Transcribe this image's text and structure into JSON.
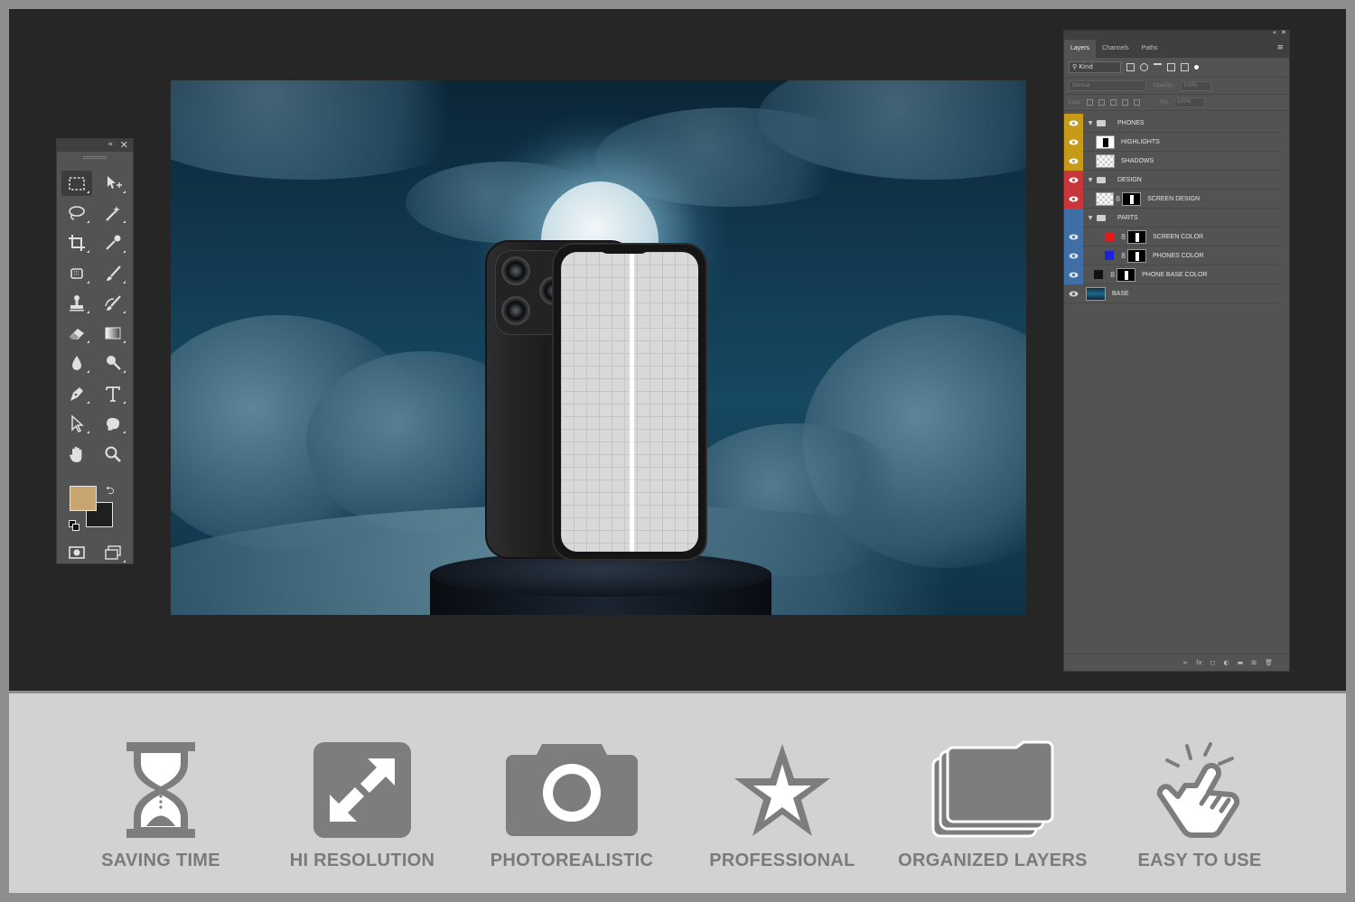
{
  "tools_panel": {
    "collapse_glyph": "«",
    "close_glyph": "✕",
    "tools": [
      {
        "name": "rectangular-marquee-tool",
        "icon": "marquee-icon",
        "selected": true
      },
      {
        "name": "move-tool",
        "icon": "move-icon"
      },
      {
        "name": "lasso-tool",
        "icon": "lasso-icon"
      },
      {
        "name": "magic-wand-tool",
        "icon": "magic-wand-icon"
      },
      {
        "name": "crop-tool",
        "icon": "crop-icon"
      },
      {
        "name": "eyedropper-tool",
        "icon": "eyedropper-icon"
      },
      {
        "name": "spot-healing-tool",
        "icon": "healing-icon"
      },
      {
        "name": "brush-tool",
        "icon": "brush-icon"
      },
      {
        "name": "clone-stamp-tool",
        "icon": "stamp-icon"
      },
      {
        "name": "history-brush-tool",
        "icon": "history-brush-icon"
      },
      {
        "name": "eraser-tool",
        "icon": "eraser-icon"
      },
      {
        "name": "gradient-tool",
        "icon": "gradient-icon"
      },
      {
        "name": "blur-tool",
        "icon": "blur-drop-icon"
      },
      {
        "name": "dodge-tool",
        "icon": "dodge-icon"
      },
      {
        "name": "pen-tool",
        "icon": "pen-icon"
      },
      {
        "name": "type-tool",
        "icon": "type-icon",
        "glyph": "T"
      },
      {
        "name": "path-selection-tool",
        "icon": "path-selection-icon"
      },
      {
        "name": "custom-shape-tool",
        "icon": "shape-icon"
      },
      {
        "name": "hand-tool",
        "icon": "hand-icon"
      },
      {
        "name": "zoom-tool",
        "icon": "zoom-icon"
      }
    ],
    "foreground_color": "#c8a46f",
    "background_color": "#1f1f1f",
    "swap_glyph": "⮌"
  },
  "layers_panel": {
    "collapse_glyph": "«",
    "close_glyph": "✕",
    "menu_glyph": "≡",
    "tabs": [
      {
        "label": "Layers",
        "active": true
      },
      {
        "label": "Channels",
        "active": false
      },
      {
        "label": "Paths",
        "active": false
      }
    ],
    "filter_label": "Kind",
    "blend_mode": "Normal",
    "opacity_label": "Opacity:",
    "opacity_value": "100%",
    "lock_label": "Lock:",
    "fill_label": "Fill:",
    "fill_value": "100%",
    "layers": [
      {
        "name": "PHONES",
        "type": "group",
        "color": "#c79b17",
        "indent": 0
      },
      {
        "name": "HIGHLIGHTS",
        "type": "layer",
        "color": "#c79b17",
        "indent": 1,
        "thumb": "checker-dark"
      },
      {
        "name": "SHADOWS",
        "type": "layer",
        "color": "#c79b17",
        "indent": 1,
        "thumb": "checker"
      },
      {
        "name": "DESIGN",
        "type": "group",
        "color": "#c8353a",
        "indent": 0
      },
      {
        "name": "SCREEN DESIGN",
        "type": "smart",
        "color": "#c8353a",
        "indent": 1
      },
      {
        "name": "PARTS",
        "type": "group",
        "color": "#3f6fa6",
        "indent": 0,
        "hidden": true
      },
      {
        "name": "SCREEN COLOR",
        "type": "fill",
        "color": "#3f6fa6",
        "indent": 1,
        "swatch": "#e51919"
      },
      {
        "name": "PHONES COLOR",
        "type": "fill",
        "color": "#3f6fa6",
        "indent": 1,
        "swatch": "#1b23d9"
      },
      {
        "name": "PHONE BASE COLOR",
        "type": "fill",
        "color": "#3f6fa6",
        "indent": 0,
        "swatch": "#111111"
      },
      {
        "name": "BASE",
        "type": "image",
        "color": "",
        "indent": 0
      }
    ],
    "bottom_icons": [
      "link-layers-icon",
      "fx-icon",
      "add-mask-icon",
      "adjustment-icon",
      "new-group-icon",
      "new-layer-icon",
      "delete-layer-icon"
    ],
    "bottom_glyphs": [
      "∞",
      "fx",
      "◻",
      "◐",
      "▬",
      "⊞",
      "🗑"
    ]
  },
  "features": [
    {
      "label": "SAVING TIME",
      "icon": "hourglass-icon"
    },
    {
      "label": "HI RESOLUTION",
      "icon": "expand-arrows-icon"
    },
    {
      "label": "PHOTOREALISTIC",
      "icon": "camera-icon"
    },
    {
      "label": "PROFESSIONAL",
      "icon": "star-icon"
    },
    {
      "label": "ORGANIZED LAYERS",
      "icon": "stacked-folders-icon"
    },
    {
      "label": "EASY TO USE",
      "icon": "tap-hand-icon"
    }
  ],
  "colors": {
    "feature_icon": "#7d7d7d",
    "workspace": "#262626",
    "panel": "#535353"
  }
}
